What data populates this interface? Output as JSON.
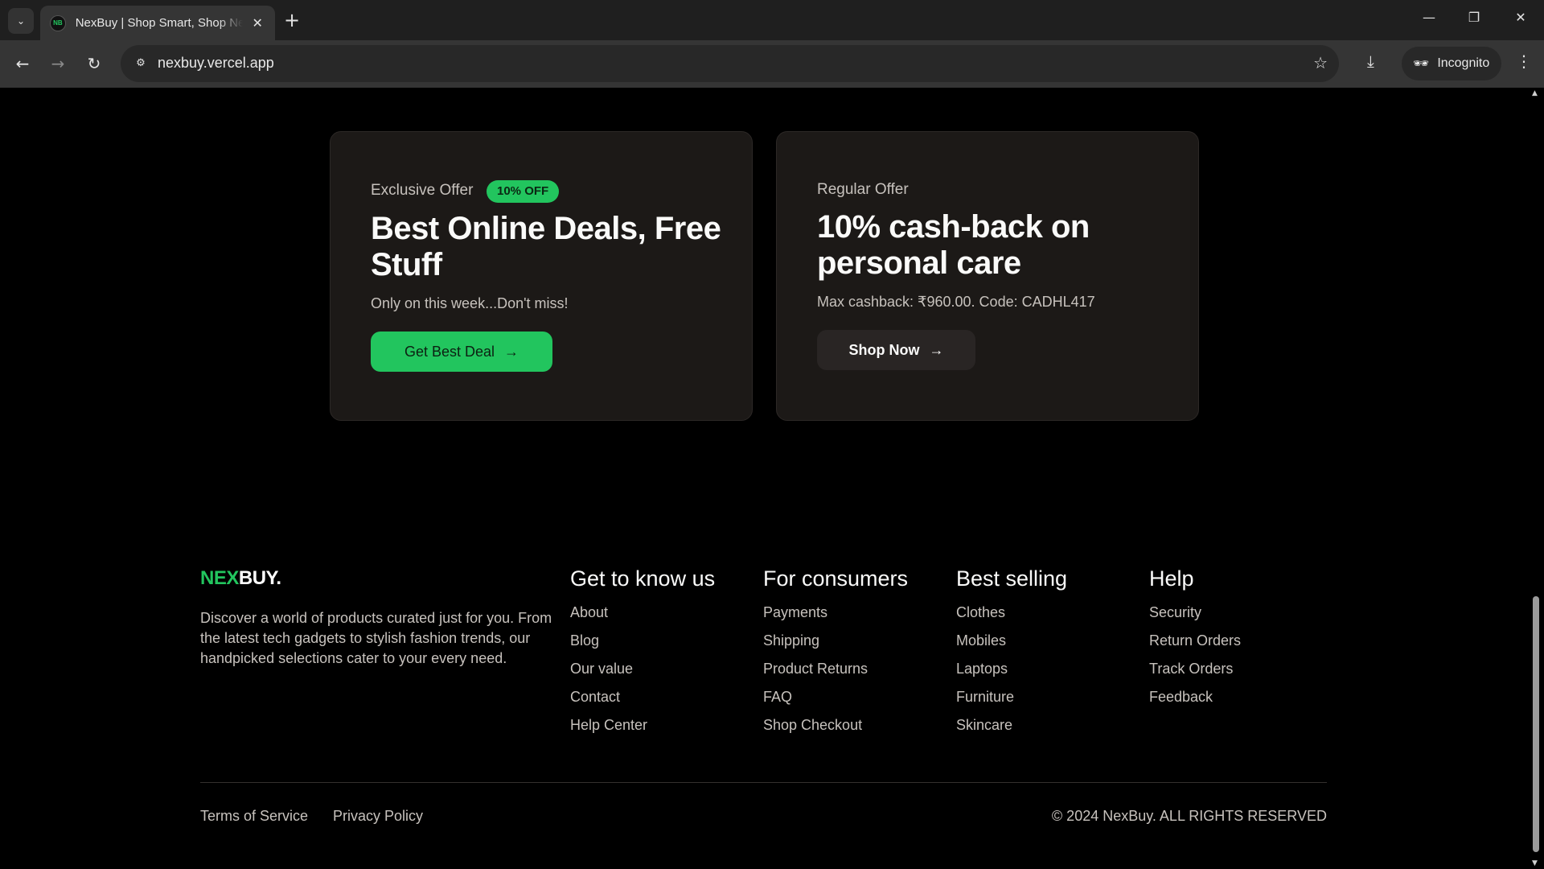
{
  "browser": {
    "tab_title": "NexBuy | Shop Smart, Shop Next",
    "favicon_text": "NB",
    "url": "nexbuy.vercel.app",
    "incognito_label": "Incognito"
  },
  "offers": [
    {
      "label": "Exclusive Offer",
      "badge": "10% OFF",
      "title": "Best Online Deals, Free Stuff",
      "subtitle": "Only on this week...Don't miss!",
      "button": "Get Best Deal"
    },
    {
      "label": "Regular Offer",
      "title": "10% cash-back on personal care",
      "subtitle": "Max cashback: ₹960.00. Code: CADHL417",
      "button": "Shop Now"
    }
  ],
  "footer": {
    "logo_part1": "NEX",
    "logo_part2": "BUY.",
    "description": "Discover a world of products curated just for you. From the latest tech gadgets to stylish fashion trends, our handpicked selections cater to your every need.",
    "columns": [
      {
        "title": "Get to know us",
        "links": [
          "About",
          "Blog",
          "Our value",
          "Contact",
          "Help Center"
        ]
      },
      {
        "title": "For consumers",
        "links": [
          "Payments",
          "Shipping",
          "Product Returns",
          "FAQ",
          "Shop Checkout"
        ]
      },
      {
        "title": "Best selling",
        "links": [
          "Clothes",
          "Mobiles",
          "Laptops",
          "Furniture",
          "Skincare"
        ]
      },
      {
        "title": "Help",
        "links": [
          "Security",
          "Return Orders",
          "Track Orders",
          "Feedback"
        ]
      }
    ],
    "terms": "Terms of Service",
    "privacy": "Privacy Policy",
    "copyright": "© 2024 NexBuy. ALL RIGHTS RESERVED"
  },
  "colors": {
    "accent": "#22c55e",
    "card_bg": "#1c1917",
    "page_bg": "#000000"
  }
}
